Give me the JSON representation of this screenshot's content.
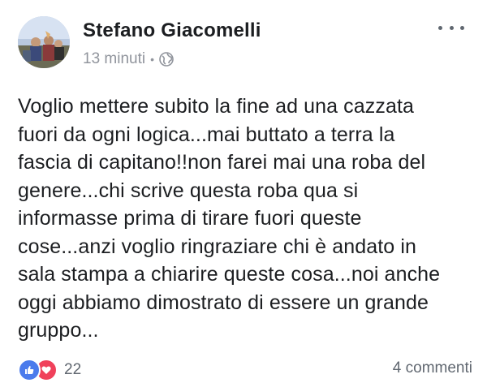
{
  "post": {
    "author": "Stefano Giacomelli",
    "time": "13 minuti",
    "separator": "•",
    "privacy_icon": "globe-icon",
    "more_icon": "more-options-icon",
    "text": "Voglio mettere subito la fine ad una cazzata\nfuori da ogni logica...mai buttato a terra la\nfascia di capitano!!non farei mai una roba del\ngenere...chi scrive questa roba qua si\ninformasse prima di tirare fuori queste\ncose...anzi voglio ringraziare chi è andato in\nsala stampa a chiarire queste cosa...noi anche\noggi abbiamo dimostrato di essere un grande\ngruppo..."
  },
  "footer": {
    "reaction_icons": [
      "like-icon",
      "love-icon"
    ],
    "reaction_count": "22",
    "comments": "4 commenti"
  },
  "colors": {
    "like": "#4b7bec",
    "love": "#f0415b",
    "meta_text": "#90949c"
  }
}
